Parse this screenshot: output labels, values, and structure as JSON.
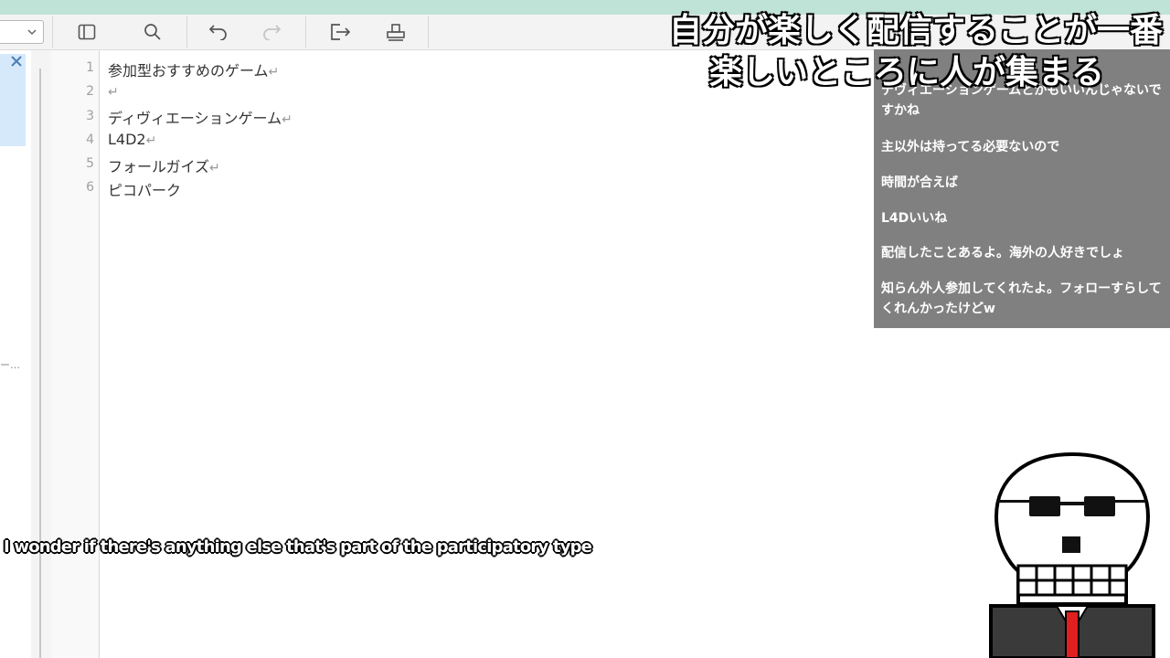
{
  "toolbar": {
    "combo_icon": "chevron-down-icon",
    "buttons": [
      {
        "name": "toggle-sidebar-button",
        "icon": "sidebar-icon"
      },
      {
        "name": "search-button",
        "icon": "search-icon"
      },
      {
        "name": "undo-button",
        "icon": "undo-icon"
      },
      {
        "name": "redo-button",
        "icon": "redo-icon"
      },
      {
        "name": "export-button",
        "icon": "export-icon"
      },
      {
        "name": "print-button",
        "icon": "print-icon"
      }
    ]
  },
  "sidebar": {
    "truncated_text": "ー…"
  },
  "editor": {
    "eol_marker": "↵",
    "lines": [
      {
        "number": "1",
        "text": "参加型おすすめのゲーム",
        "eol": true
      },
      {
        "number": "2",
        "text": "",
        "eol": true
      },
      {
        "number": "3",
        "text": "ディヴィエーションゲーム",
        "eol": true
      },
      {
        "number": "4",
        "text": "L4D2",
        "eol": true
      },
      {
        "number": "5",
        "text": "フォールガイズ",
        "eol": true
      },
      {
        "number": "6",
        "text": "ピコパーク",
        "eol": false
      }
    ]
  },
  "chat": {
    "messages": [
      "デヴィエーションゲームとかもいいんじゃないですかね",
      "主以外は持ってる必要ないので",
      "時間が合えば",
      "L4Dいいね",
      "配信したことあるよ。海外の人好きでしょ",
      "知らん外人参加してくれたよ。フォローすらしてくれんかったけどw"
    ]
  },
  "overlay": {
    "title_line1": "自分が楽しく配信することが一番",
    "title_line2": "楽しいところに人が集まる",
    "subtitle": "I wonder if there's anything else that's part of the participatory type"
  },
  "colors": {
    "top_strip": "#bfe3d6",
    "chat_bg": "#808080",
    "selection": "#d5e9fb",
    "tie": "#e0201e"
  }
}
